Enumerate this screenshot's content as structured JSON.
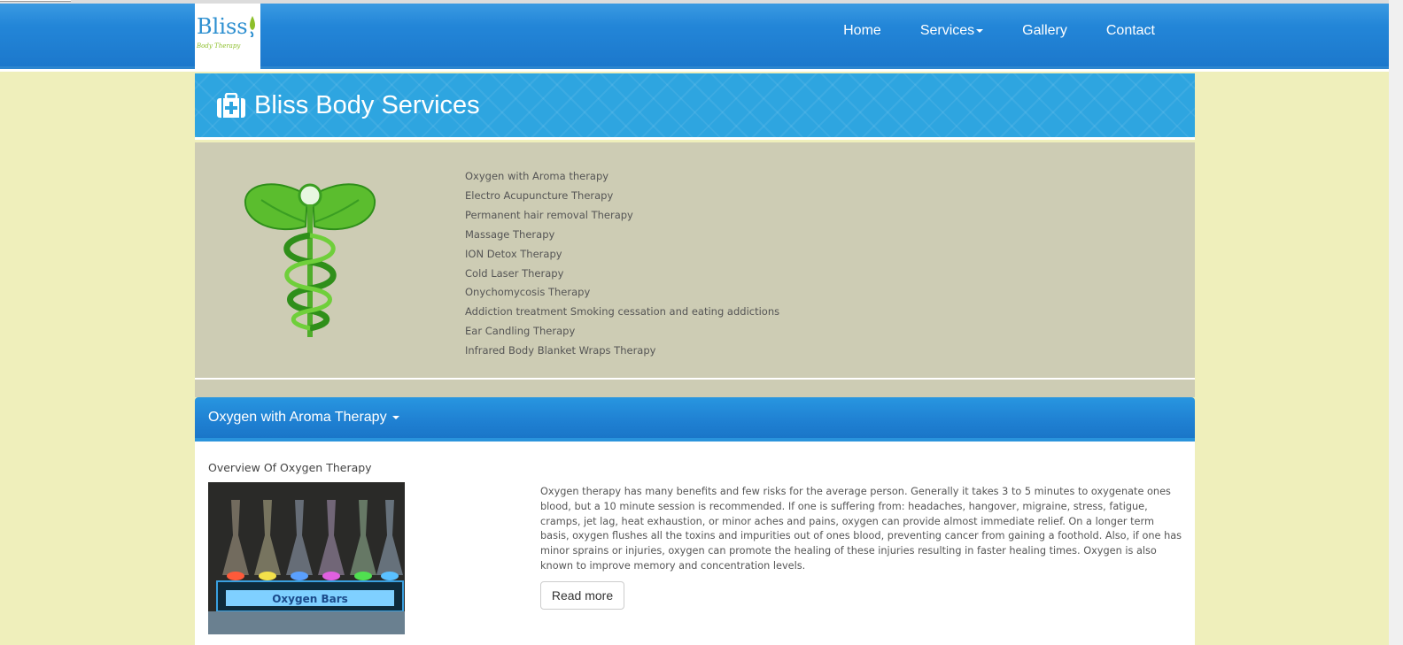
{
  "logo": {
    "word": "Bliss",
    "tagline": "Body Therapy"
  },
  "nav": {
    "home": "Home",
    "services": "Services",
    "gallery": "Gallery",
    "contact": "Contact"
  },
  "banner": {
    "title": "Bliss Body Services"
  },
  "services": [
    "Oxygen with Aroma therapy",
    "Electro Acupuncture Therapy",
    "Permanent hair removal Therapy",
    "Massage Therapy",
    "ION Detox Therapy",
    "Cold Laser Therapy",
    "Onychomycosis Therapy",
    "Addiction treatment Smoking cessation and eating addictions",
    "Ear Candling Therapy",
    "Infrared Body Blanket Wraps Therapy"
  ],
  "section": {
    "header": "Oxygen with Aroma Therapy",
    "overview_title": "Overview Of Oxygen Therapy",
    "photo_label": "Oxygen Bars",
    "body": "Oxygen therapy has many benefits and few risks for the average person. Generally it takes 3 to 5 minutes to oxygenate ones blood, but a 10 minute session is recommended. If one is suffering from: headaches, hangover, migraine, stress, fatigue, cramps, jet lag, heat exhaustion, or minor aches and pains, oxygen can provide almost immediate relief. On a longer term basis, oxygen flushes all the toxins and impurities out of ones blood, preventing cancer from gaining a foothold. Also, if one has minor sprains or injuries, oxygen can promote the healing of these injuries resulting in faster healing times. Oxygen is also known to improve memory and concentration levels.",
    "read_more": "Read more"
  },
  "colors": {
    "navbar": "#2386d8",
    "banner": "#2ea5e0",
    "page_bg": "#efefbb",
    "panel_bg": "#cdccb4"
  }
}
